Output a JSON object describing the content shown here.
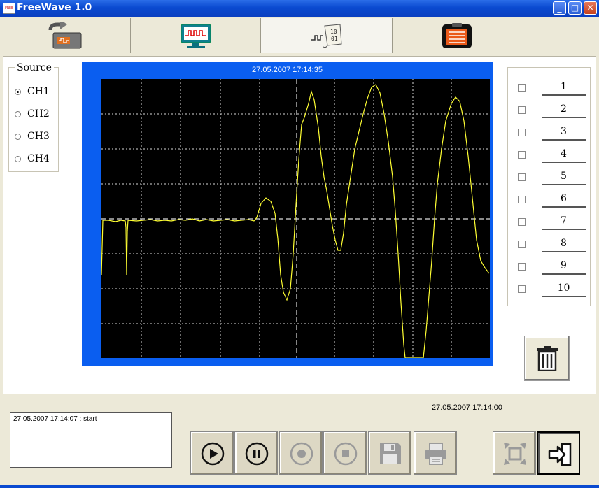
{
  "window": {
    "title": "FreeWave 1.0",
    "app_icon_text": "FREE",
    "minimize_glyph": "_",
    "maximize_glyph": "□",
    "close_glyph": "✕"
  },
  "toolbar": {
    "tabs": [
      {
        "name": "connect-tab",
        "icon": "device-arrow-icon"
      },
      {
        "name": "signal-monitor-tab",
        "icon": "monitor-wave-icon"
      },
      {
        "name": "data-tab",
        "icon": "wave-binary-icon"
      },
      {
        "name": "report-tab",
        "icon": "clipboard-icon"
      }
    ],
    "active_tab": 2
  },
  "source": {
    "legend": "Source",
    "options": [
      "CH1",
      "CH2",
      "CH3",
      "CH4"
    ],
    "selected": "CH1"
  },
  "scope": {
    "timestamp": "27.05.2007 17:14:35",
    "frame_color": "#0a5ef0",
    "trace_color": "#ffff33",
    "grid_color": "#ffffff"
  },
  "marks": {
    "labels": [
      "1",
      "2",
      "3",
      "4",
      "5",
      "6",
      "7",
      "8",
      "9",
      "10"
    ]
  },
  "log": {
    "entries": [
      "27.05.2007 17:14:07 : start"
    ]
  },
  "status": {
    "timestamp": "27.05.2007 17:14:00"
  },
  "controls": [
    {
      "name": "play-button",
      "icon": "play-icon",
      "enabled": true
    },
    {
      "name": "pause-button",
      "icon": "pause-icon",
      "enabled": true
    },
    {
      "name": "record-button",
      "icon": "record-icon",
      "enabled": false
    },
    {
      "name": "stop-button",
      "icon": "stop-icon",
      "enabled": false
    },
    {
      "name": "save-button",
      "icon": "floppy-icon",
      "enabled": false
    },
    {
      "name": "print-button",
      "icon": "printer-icon",
      "enabled": false
    },
    {
      "name": "fullscreen-button",
      "icon": "expand-icon",
      "enabled": false
    },
    {
      "name": "exit-button",
      "icon": "exit-arrow-icon",
      "enabled": true
    }
  ]
}
